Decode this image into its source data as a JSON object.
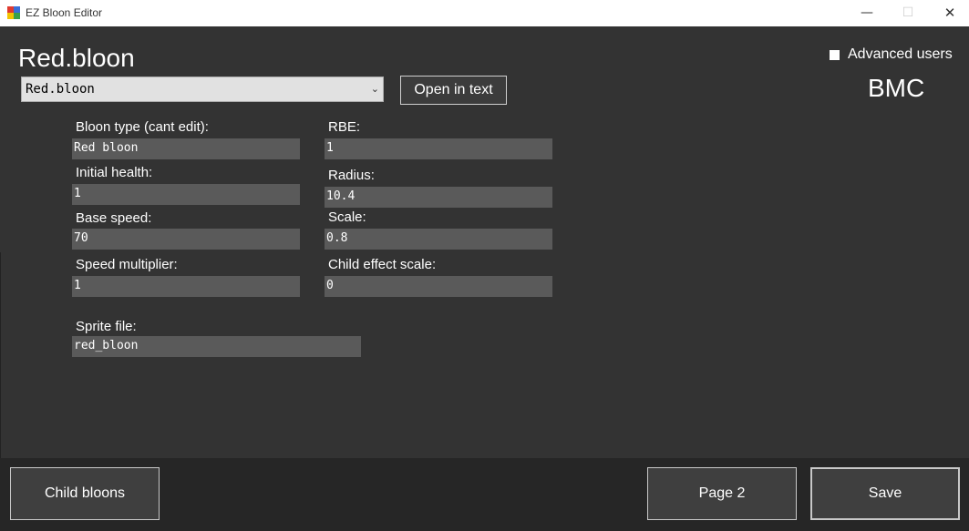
{
  "window": {
    "title": "EZ Bloon Editor",
    "minimize": "—",
    "maximize": "☐",
    "close": "✕"
  },
  "header": {
    "title": "Red.bloon",
    "selector_value": "Red.bloon",
    "open_in_text_label": "Open in text",
    "advanced_users_label": "Advanced users",
    "advanced_users_checked": false,
    "brand": "BMC"
  },
  "fields": {
    "bloon_type": {
      "label": "Bloon type  (cant edit):",
      "value": "Red bloon"
    },
    "rbe": {
      "label": "RBE:",
      "value": "1"
    },
    "initial_health": {
      "label": "Initial health:",
      "value": "1"
    },
    "radius": {
      "label": "Radius:",
      "value": "10.4"
    },
    "base_speed": {
      "label": "Base speed:",
      "value": "70"
    },
    "scale": {
      "label": "Scale:",
      "value": "0.8"
    },
    "speed_multiplier": {
      "label": "Speed multiplier:",
      "value": "1"
    },
    "child_effect_scale": {
      "label": "Child effect scale:",
      "value": "0"
    },
    "sprite_file": {
      "label": "Sprite file:",
      "value": "red_bloon"
    }
  },
  "footer": {
    "child_bloons_label": "Child bloons",
    "page2_label": "Page 2",
    "save_label": "Save"
  },
  "colors": {
    "background": "#333333",
    "footer": "#262626",
    "input": "#5a5a5a"
  }
}
